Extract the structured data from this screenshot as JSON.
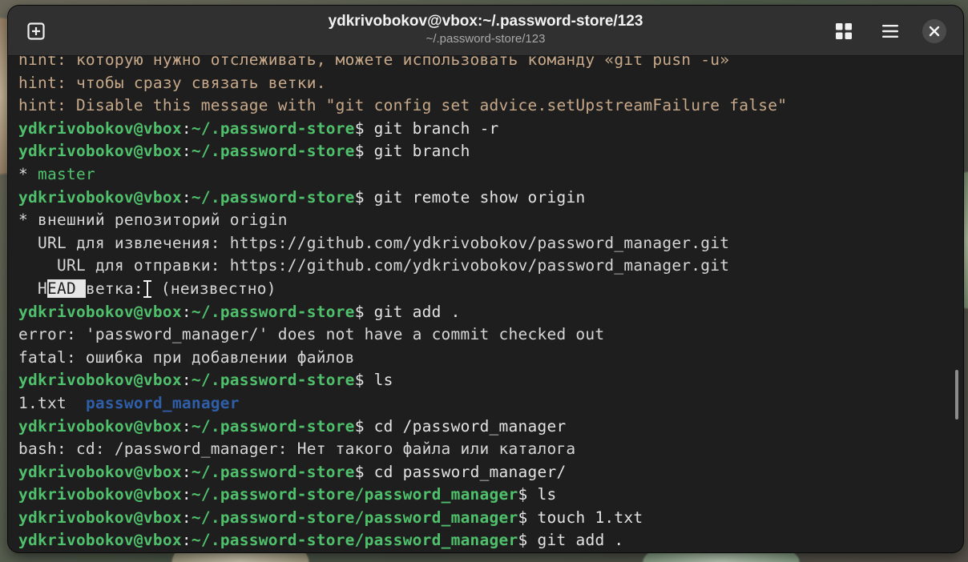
{
  "window": {
    "title": "ydkrivobokov@vbox:~/.password-store/123",
    "subtitle": "~/.password-store/123"
  },
  "icons": {
    "new_tab": "new-tab-plus-icon",
    "overview": "grid-icon",
    "menu": "hamburger-menu-icon",
    "close": "close-icon"
  },
  "colors": {
    "prompt": "#4fc06b",
    "hint": "#c7a98a",
    "directory": "#2f5fa8",
    "background": "#1e1e1e",
    "titlebar": "#303030"
  },
  "prompt": {
    "user": "ydkrivobokov@vbox",
    "colon": ":",
    "dollar": "$"
  },
  "terminal": {
    "lines": [
      {
        "hint": "hint: которую нужно отслеживать, можете использовать команду «git push -u»"
      },
      {
        "hint": "hint: чтобы сразу связать ветки."
      },
      {
        "hint": "hint: Disable this message with \"git config set advice.setUpstreamFailure false\""
      },
      {
        "path": "~/.password-store",
        "cmd": " git branch -r"
      },
      {
        "path": "~/.password-store",
        "cmd": " git branch"
      },
      {
        "star": "* ",
        "branch": "master"
      },
      {
        "path": "~/.password-store",
        "cmd": " git remote show origin"
      },
      {
        "out": "* внешний репозиторий origin"
      },
      {
        "out": "  URL для извлечения: https://github.com/ydkrivobokov/password_manager.git"
      },
      {
        "out": "    URL для отправки: https://github.com/ydkrivobokov/password_manager.git"
      },
      {
        "pre": "  H",
        "selected": "EAD ",
        "post": "ветка:",
        "after": " (неизвестно)"
      },
      {
        "path": "~/.password-store",
        "cmd": " git add ."
      },
      {
        "out": "error: 'password_manager/' does not have a commit checked out"
      },
      {
        "out": "fatal: ошибка при добавлении файлов"
      },
      {
        "path": "~/.password-store",
        "cmd": " ls"
      },
      {
        "file": "1.txt  ",
        "dir": "password_manager"
      },
      {
        "path": "~/.password-store",
        "cmd": " cd /password_manager"
      },
      {
        "out": "bash: cd: /password_manager: Нет такого файла или каталога"
      },
      {
        "path": "~/.password-store",
        "cmd": " cd password_manager/"
      },
      {
        "path": "~/.password-store/password_manager",
        "cmd": " ls"
      },
      {
        "path": "~/.password-store/password_manager",
        "cmd": " touch 1.txt"
      },
      {
        "path": "~/.password-store/password_manager",
        "cmd": " git add ."
      }
    ]
  }
}
